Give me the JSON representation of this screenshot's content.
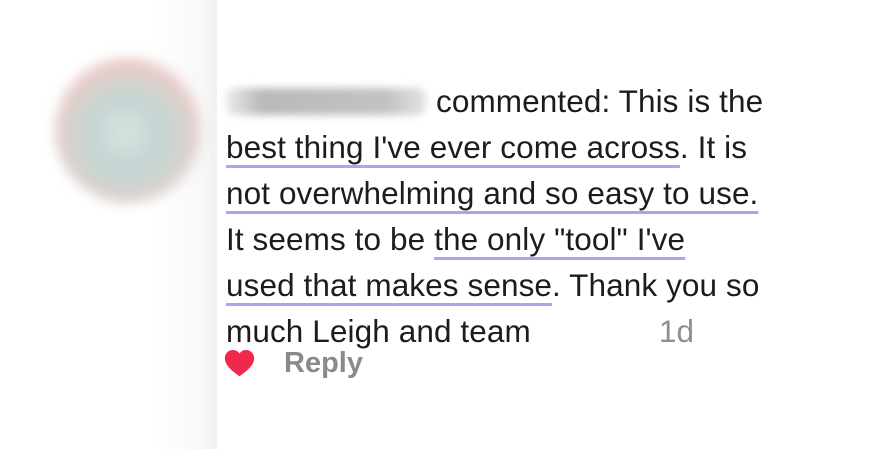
{
  "comment": {
    "verb": "commented:",
    "segments": {
      "l1_rest": " This is the",
      "hl_best": "best thing I've ever come across",
      "l2_rest": ". It is",
      "hl_overwhelm": "not overwhelming and so easy to use.",
      "l4_start": "It seems to be ",
      "hl_tool": "the only \"tool\" I've",
      "hl_sense": "used that makes sense",
      "l5_rest": ". Thank you so",
      "l6": "much Leigh and team"
    },
    "timestamp": "1d"
  },
  "actions": {
    "like_icon": "heart-icon",
    "reply_label": "Reply"
  },
  "colors": {
    "underline": "#a6a8ef",
    "heart": "#f02849",
    "meta_gray": "#8e8e93"
  }
}
